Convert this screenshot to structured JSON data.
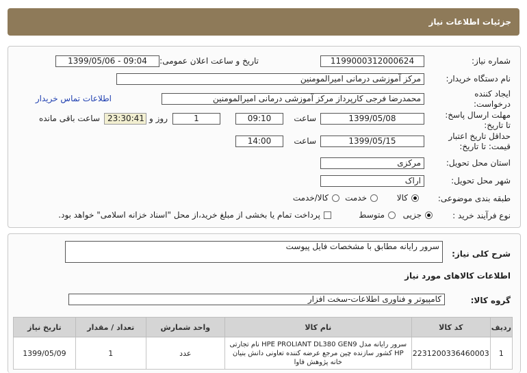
{
  "header": {
    "title": "جزئیات اطلاعات نیاز"
  },
  "form": {
    "need_number_label": "شماره نیاز:",
    "need_number": "1199000312000624",
    "announce_label": "تاریخ و ساعت اعلان عمومی:",
    "announce_value": "1399/05/06 - 09:04",
    "buyer_label": "نام دستگاه خریدار:",
    "buyer_value": "مرکز آموزشی درمانی امیرالمومنین",
    "creator_label_1": "ایجاد کننده",
    "creator_label_2": "درخواست:",
    "creator_value": "محمدرضا فرجی کارپرداز مرکز آموزشی درمانی امیرالمومنین",
    "contact_link": "اطلاعات تماس خریدار",
    "deadline_label_1": "مهلت ارسال پاسخ:",
    "deadline_label_2": "تا تاریخ:",
    "deadline_date": "1399/05/08",
    "time_label": "ساعت",
    "deadline_time": "09:10",
    "days_value": "1",
    "days_label": "روز و",
    "remaining_time": "23:30:41",
    "remaining_label": "ساعت باقی مانده",
    "validity_label_1": "حداقل تاریخ اعتبار",
    "validity_label_2": "قیمت: تا تاریخ:",
    "validity_date": "1399/05/15",
    "validity_time_label": "ساعت",
    "validity_time": "14:00",
    "province_label": "استان محل تحویل:",
    "province_value": "مرکزی",
    "city_label": "شهر محل تحویل:",
    "city_value": "اراک",
    "category_label": "طبقه بندی موضوعی:",
    "category_options": [
      "کالا",
      "خدمت",
      "کالا/خدمت"
    ],
    "category_selected": "کالا",
    "process_label": "نوع فرآیند خرید :",
    "process_options": [
      "جزیی",
      "متوسط"
    ],
    "process_selected": "جزیی",
    "payment_note": "پرداخت تمام یا بخشی از مبلغ خرید،از محل \"اسناد خزانه اسلامی\" خواهد بود."
  },
  "description": {
    "label": "شرح کلی نیاز:",
    "value": "سرور رایانه مطابق با مشخصات فایل پیوست"
  },
  "goods": {
    "section_title": "اطلاعات کالاهای مورد نیاز",
    "group_label": "گروه کالا:",
    "group_value": "کامپیوتر و فناوری اطلاعات-سخت افزار",
    "columns": [
      "ردیف",
      "کد کالا",
      "نام کالا",
      "واحد شمارش",
      "تعداد / مقدار",
      "تاریخ نیاز"
    ],
    "rows": [
      {
        "row": "1",
        "code": "2231200336460003",
        "name": "سرور رایانه مدل HPE PROLIANT DL380 GEN9 نام تجارتی HP کشور سازنده چین مرجع عرضه کننده تعاونی دانش بنیان خانه پژوهش فاوا",
        "unit": "عدد",
        "qty": "1",
        "date": "1399/05/09"
      }
    ]
  },
  "colors": {
    "header_bg": "#8e7a59",
    "link": "#1f3fb0",
    "timer_bg": "#f2efd1"
  }
}
